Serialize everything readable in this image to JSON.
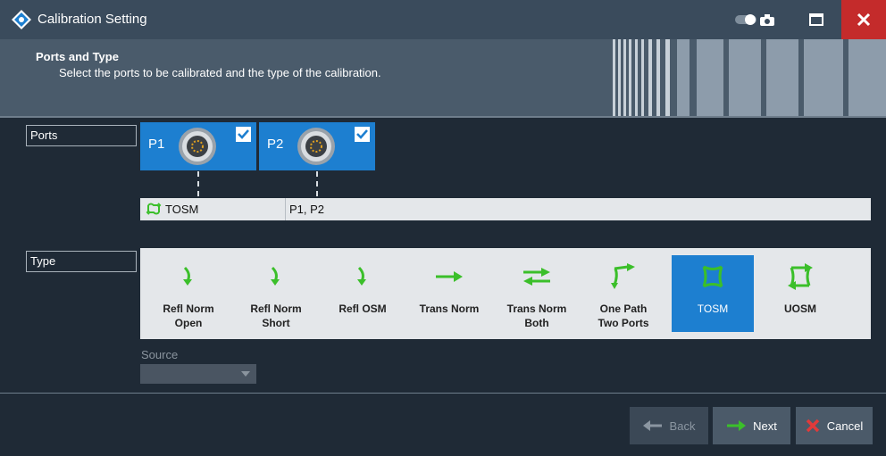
{
  "window": {
    "title": "Calibration Setting"
  },
  "header": {
    "title": "Ports and Type",
    "subtitle": "Select the ports to be calibrated and the type of the calibration."
  },
  "ports": {
    "label": "Ports",
    "items": [
      {
        "name": "P1",
        "checked": true
      },
      {
        "name": "P2",
        "checked": true
      }
    ],
    "assignment": {
      "type": "TOSM",
      "ports": "P1, P2"
    }
  },
  "type": {
    "label": "Type",
    "selected": "TOSM",
    "options": [
      {
        "line1": "Refl Norm",
        "line2": "Open",
        "icon": "refl-arrow-icon"
      },
      {
        "line1": "Refl Norm",
        "line2": "Short",
        "icon": "refl-arrow-icon"
      },
      {
        "line1": "Refl OSM",
        "line2": "",
        "icon": "refl-arrow-icon"
      },
      {
        "line1": "Trans Norm",
        "line2": "",
        "icon": "trans-arrow-icon"
      },
      {
        "line1": "Trans Norm",
        "line2": "Both",
        "icon": "bidirectional-arrow-icon"
      },
      {
        "line1": "One Path",
        "line2": "Two Ports",
        "icon": "one-path-icon"
      },
      {
        "line1": "TOSM",
        "line2": "",
        "icon": "tosm-icon"
      },
      {
        "line1": "UOSM",
        "line2": "",
        "icon": "uosm-icon"
      }
    ]
  },
  "source": {
    "label": "Source",
    "value": ""
  },
  "footer": {
    "back": "Back",
    "next": "Next",
    "cancel": "Cancel"
  },
  "colors": {
    "accent": "#1d7fd0",
    "arrow_green": "#3bbf2a",
    "close_red": "#c42b2b"
  }
}
